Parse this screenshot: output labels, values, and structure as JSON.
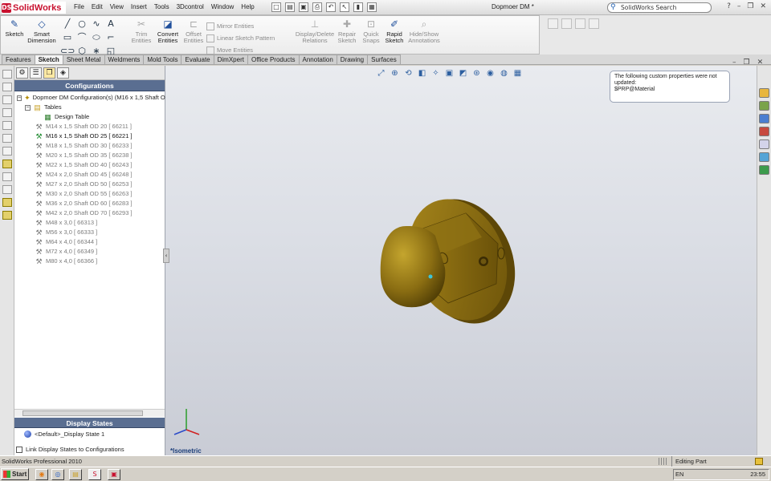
{
  "app": {
    "logo_text": "SolidWorks",
    "document_title": "Dopmoer DM *"
  },
  "menu": [
    "File",
    "Edit",
    "View",
    "Insert",
    "Tools",
    "3Dcontrol",
    "Window",
    "Help"
  ],
  "search": {
    "placeholder": "SolidWorks Search"
  },
  "ribbon": {
    "sketch": "Sketch",
    "smart_dimension": "Smart Dimension",
    "trim": "Trim Entities",
    "convert": "Convert Entities",
    "offset": "Offset Entities",
    "mirror": "Mirror Entities",
    "linear_pattern": "Linear Sketch Pattern",
    "move": "Move Entities",
    "display_delete": "Display/Delete Relations",
    "repair": "Repair Sketch",
    "quick_snaps": "Quick Snaps",
    "rapid_sketch": "Rapid Sketch",
    "hide_show": "Hide/Show Annotations"
  },
  "tabs": [
    "Features",
    "Sketch",
    "Sheet Metal",
    "Weldments",
    "Mold Tools",
    "Evaluate",
    "DimXpert",
    "Office Products",
    "Annotation",
    "Drawing",
    "Surfaces"
  ],
  "active_tab": "Sketch",
  "config_pane": {
    "title": "Configurations",
    "root": "Dopmoer DM Configuration(s)  (M16 x 1,5 Shaft O",
    "tables": "Tables",
    "design_table": "Design Table",
    "configs": [
      "M14 x 1,5 Shaft OD 20 [ 66211 ]",
      "M16 x 1,5 Shaft OD 25 [ 66221 ]",
      "M18 x 1,5 Shaft OD 30 [ 66233 ]",
      "M20 x 1,5 Shaft OD 35 [ 66238 ]",
      "M22 x 1,5 Shaft OD 40 [ 66243 ]",
      "M24 x 2,0 Shaft OD 45 [ 66248 ]",
      "M27 x 2,0 Shaft OD 50 [ 66253 ]",
      "M30 x 2,0 Shaft OD 55 [ 66263 ]",
      "M36 x 2,0 Shaft OD 60 [ 66283 ]",
      "M42 x 2,0 Shaft OD 70 [ 66293 ]",
      "M48 x 3,0 [ 66313 ]",
      "M56 x 3,0 [ 66333 ]",
      "M64 x 4,0 [ 66344 ]",
      "M72 x 4,0 [ 66349 ]",
      "M80 x 4,0 [ 66366 ]"
    ],
    "active_index": 1
  },
  "display_states": {
    "title": "Display States",
    "item": "<Default>_Display State 1",
    "link_label": "Link Display States to Configurations"
  },
  "note": {
    "line1": "The following custom properties were not",
    "line2": "updated:",
    "line3": "$PRP@Material"
  },
  "view": {
    "label": "*Isometric"
  },
  "status": {
    "left": "SolidWorks Professional 2010",
    "mode": "Editing Part"
  },
  "taskbar": {
    "start": "Start",
    "lang": "EN",
    "clock": "23:55"
  },
  "colors": {
    "model": "#8a6d12",
    "pane_header": "#5a6e91",
    "background_top": "#e9ebef"
  }
}
